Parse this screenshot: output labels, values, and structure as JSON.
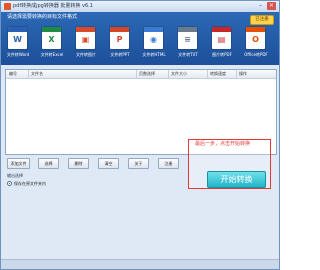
{
  "window": {
    "title": "pdf转换成jpg转换器 批量转换 v6.1",
    "min_glyph": "–",
    "close_glyph": "×"
  },
  "header": {
    "instruction": "请选择需要转换的目标文件格式",
    "register_label": "已注册"
  },
  "converters": [
    {
      "label": "文件转Word",
      "icon": "word-icon",
      "glyph": "W",
      "color": "#2b5fb4"
    },
    {
      "label": "文件转Excel",
      "icon": "excel-icon",
      "glyph": "X",
      "color": "#1e8a44"
    },
    {
      "label": "文件转图片",
      "icon": "image-icon",
      "glyph": "▣",
      "color": "#d84b2a"
    },
    {
      "label": "文件转PPT",
      "icon": "ppt-icon",
      "glyph": "P",
      "color": "#d24726"
    },
    {
      "label": "文件转HTML",
      "icon": "html-icon",
      "glyph": "◉",
      "color": "#3a7bd5"
    },
    {
      "label": "文件转TXT",
      "icon": "txt-icon",
      "glyph": "≡",
      "color": "#6b7a8c"
    },
    {
      "label": "图片转PDF",
      "icon": "img-to-pdf-icon",
      "glyph": "▤",
      "color": "#c62828"
    },
    {
      "label": "Office转PDF",
      "icon": "office-to-pdf-icon",
      "glyph": "O",
      "color": "#e65100"
    }
  ],
  "file_list": {
    "columns": [
      "编号",
      "文件名",
      "页数选择",
      "文件大小",
      "转换速度",
      "操作"
    ],
    "rows": []
  },
  "toolbar": {
    "add_files": "添加文件",
    "select": "选择",
    "delete": "删除",
    "clear": "清空",
    "about": "关于",
    "register": "注册"
  },
  "output": {
    "section_label": "输出选择",
    "option_label": "保存在原文件夹内"
  },
  "callout": {
    "hint": "最后一步，点击开始转换"
  },
  "start_button": {
    "label": "开始转换"
  },
  "colors": {
    "header_blue": "#1d4f9a",
    "start_teal": "#23b3c7",
    "highlight_red": "#e53935"
  }
}
